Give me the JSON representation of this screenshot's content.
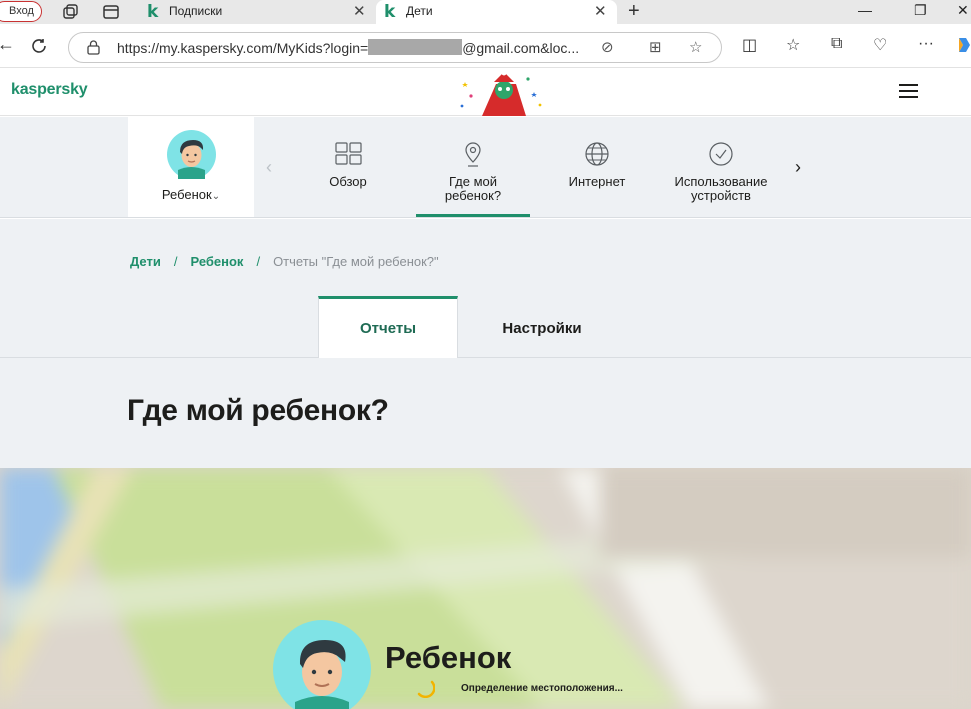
{
  "browser": {
    "profile_label": "Вход",
    "tabs": [
      {
        "title": "Подписки",
        "icon": "kaspersky-k-icon"
      },
      {
        "title": "Дети",
        "icon": "kaspersky-k-icon",
        "active": true
      }
    ],
    "url_prefix": "https://my.kaspersky.com/MyKids?login=",
    "url_suffix": "@gmail.com&loc..."
  },
  "site": {
    "logo": "kaspersky",
    "accent_color": "#1f8f6b"
  },
  "child_nav": {
    "child_name": "Ребенок",
    "items": [
      {
        "label": "Обзор",
        "icon": "overview-grid-icon"
      },
      {
        "label": "Где мой\nребенок?",
        "icon": "location-pin-icon",
        "active": true
      },
      {
        "label": "Интернет",
        "icon": "globe-icon"
      },
      {
        "label": "Использование\nустройств",
        "icon": "clock-icon"
      }
    ]
  },
  "breadcrumb": {
    "items": [
      "Дети",
      "Ребенок"
    ],
    "current": "Отчеты \"Где мой ребенок?\""
  },
  "subtabs": [
    {
      "label": "Отчеты",
      "active": true
    },
    {
      "label": "Настройки"
    }
  ],
  "page_title": "Где мой ребенок?",
  "map_card": {
    "child_name": "Ребенок",
    "status": "Определение местоположения..."
  }
}
